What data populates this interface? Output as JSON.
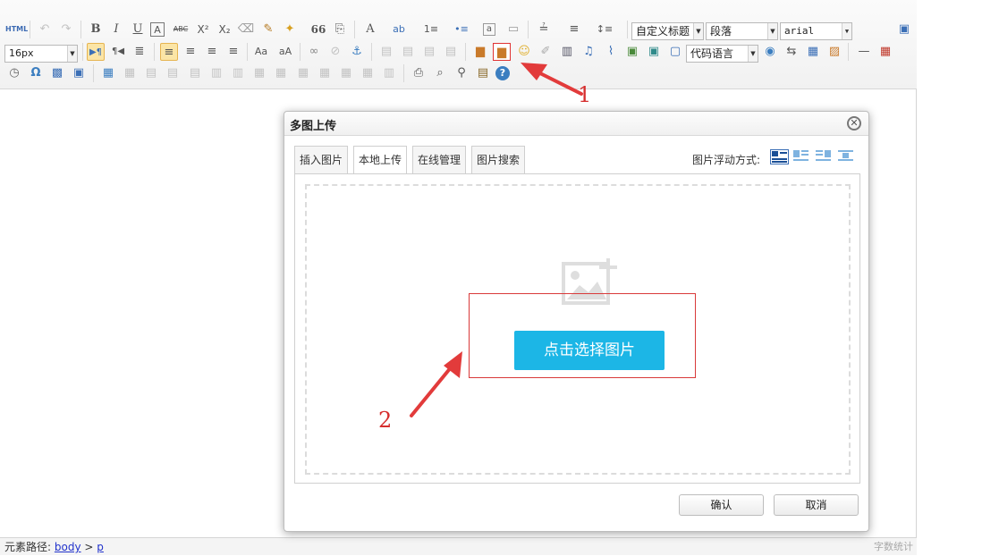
{
  "toolbar": {
    "row1": {
      "source": "HTML",
      "undo": "↶",
      "redo": "↷",
      "bold": "B",
      "italic": "I",
      "underline": "U",
      "fontborder": "A",
      "strike": "ABC",
      "superscript": "X²",
      "subscript": "X₂",
      "removeformat": "⌫",
      "formatmatch": "✎",
      "autotypeset": "✦",
      "blockquote": "66",
      "pasteplain": "⎘",
      "forecolor": "A",
      "backcolor": "ab",
      "orderedlist": "1≡",
      "unorderedlist": "•≡",
      "selectall": "a",
      "cleardoc": "▭",
      "rowspacingtop": "≟",
      "rowspacingbottom": "≡",
      "lineheight": "↕≡",
      "customstyle": "自定义标题",
      "paragraph": "段落",
      "fontfamily": "arial",
      "fullscreen": "▣"
    },
    "row2": {
      "fontsize": "16px",
      "ltr": "▶¶",
      "rtl": "¶◀",
      "indent": "≣",
      "justify_left": "≡",
      "justify_center": "≡",
      "justify_right": "≡",
      "justify_full": "≡",
      "touppercase": "Aa",
      "tolowercase": "aA",
      "link": "∞",
      "unlink": "⊘",
      "anchor": "⚓",
      "insertcode_label": "代码语言",
      "horizontal": "—",
      "date": "▦"
    },
    "row3": {
      "time": "◷",
      "spechars": "Ω",
      "help": "?"
    }
  },
  "dialog": {
    "title": "多图上传",
    "close": "✕",
    "tabs": [
      {
        "label": "插入图片"
      },
      {
        "label": "本地上传"
      },
      {
        "label": "在线管理"
      },
      {
        "label": "图片搜索"
      }
    ],
    "active_tab": "本地上传",
    "float_label": "图片浮动方式:",
    "pick_button": "点击选择图片",
    "confirm": "确认",
    "cancel": "取消"
  },
  "status": {
    "path_label": "元素路径:",
    "path_body": "body",
    "path_sep": ">",
    "path_p": "p",
    "wordcount": "字数统计"
  },
  "annotations": {
    "n1": "1",
    "n2": "2",
    "color": "#d62e2e"
  },
  "colors": {
    "accent": "#1cb6e6",
    "annotation": "#d62e2e",
    "active_tool": "#fbe5a6"
  }
}
